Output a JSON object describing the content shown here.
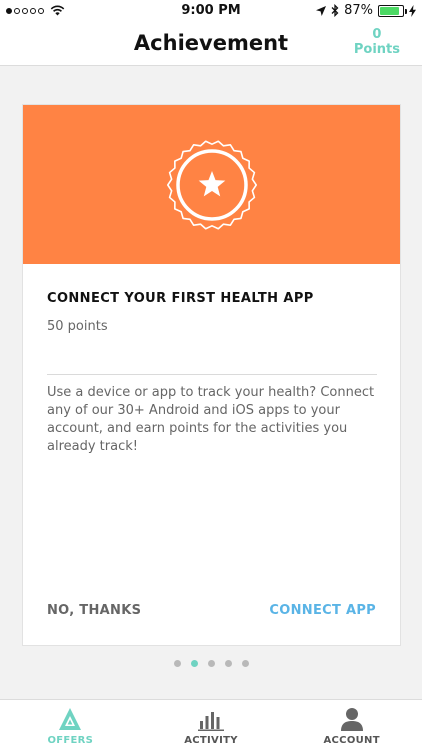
{
  "status": {
    "time": "9:00 PM",
    "battery": "87%",
    "battery_level": 0.87
  },
  "header": {
    "title": "Achievement",
    "points_value": "0",
    "points_label": "Points"
  },
  "card": {
    "hero_icon": "star-badge-icon",
    "hero_color": "#ff8344",
    "title": "CONNECT YOUR FIRST HEALTH APP",
    "points": "50 points",
    "description": "Use a device or app to track your health? Connect any of our 30+ Android and iOS apps to your account, and earn points for the activities you already track!",
    "decline_label": "NO, THANKS",
    "accept_label": "CONNECT APP"
  },
  "pager": {
    "count": 5,
    "active_index": 1
  },
  "tabs": [
    {
      "label": "OFFERS",
      "icon": "offers-icon",
      "active": true
    },
    {
      "label": "ACTIVITY",
      "icon": "activity-icon",
      "active": false
    },
    {
      "label": "ACCOUNT",
      "icon": "account-icon",
      "active": false
    }
  ],
  "colors": {
    "accent": "#6fd3c2",
    "link": "#5ab4e6",
    "hero": "#ff8344"
  }
}
